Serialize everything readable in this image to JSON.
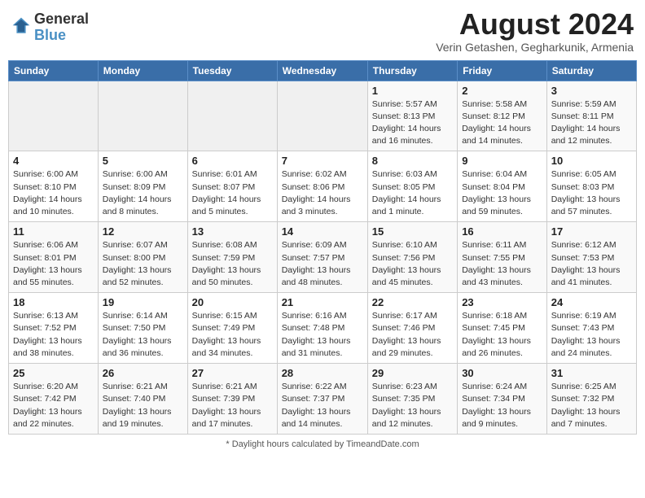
{
  "header": {
    "logo_line1": "General",
    "logo_line2": "Blue",
    "month": "August 2024",
    "location": "Verin Getashen, Gegharkunik, Armenia"
  },
  "weekdays": [
    "Sunday",
    "Monday",
    "Tuesday",
    "Wednesday",
    "Thursday",
    "Friday",
    "Saturday"
  ],
  "weeks": [
    [
      {
        "day": "",
        "info": ""
      },
      {
        "day": "",
        "info": ""
      },
      {
        "day": "",
        "info": ""
      },
      {
        "day": "",
        "info": ""
      },
      {
        "day": "1",
        "info": "Sunrise: 5:57 AM\nSunset: 8:13 PM\nDaylight: 14 hours\nand 16 minutes."
      },
      {
        "day": "2",
        "info": "Sunrise: 5:58 AM\nSunset: 8:12 PM\nDaylight: 14 hours\nand 14 minutes."
      },
      {
        "day": "3",
        "info": "Sunrise: 5:59 AM\nSunset: 8:11 PM\nDaylight: 14 hours\nand 12 minutes."
      }
    ],
    [
      {
        "day": "4",
        "info": "Sunrise: 6:00 AM\nSunset: 8:10 PM\nDaylight: 14 hours\nand 10 minutes."
      },
      {
        "day": "5",
        "info": "Sunrise: 6:00 AM\nSunset: 8:09 PM\nDaylight: 14 hours\nand 8 minutes."
      },
      {
        "day": "6",
        "info": "Sunrise: 6:01 AM\nSunset: 8:07 PM\nDaylight: 14 hours\nand 5 minutes."
      },
      {
        "day": "7",
        "info": "Sunrise: 6:02 AM\nSunset: 8:06 PM\nDaylight: 14 hours\nand 3 minutes."
      },
      {
        "day": "8",
        "info": "Sunrise: 6:03 AM\nSunset: 8:05 PM\nDaylight: 14 hours\nand 1 minute."
      },
      {
        "day": "9",
        "info": "Sunrise: 6:04 AM\nSunset: 8:04 PM\nDaylight: 13 hours\nand 59 minutes."
      },
      {
        "day": "10",
        "info": "Sunrise: 6:05 AM\nSunset: 8:03 PM\nDaylight: 13 hours\nand 57 minutes."
      }
    ],
    [
      {
        "day": "11",
        "info": "Sunrise: 6:06 AM\nSunset: 8:01 PM\nDaylight: 13 hours\nand 55 minutes."
      },
      {
        "day": "12",
        "info": "Sunrise: 6:07 AM\nSunset: 8:00 PM\nDaylight: 13 hours\nand 52 minutes."
      },
      {
        "day": "13",
        "info": "Sunrise: 6:08 AM\nSunset: 7:59 PM\nDaylight: 13 hours\nand 50 minutes."
      },
      {
        "day": "14",
        "info": "Sunrise: 6:09 AM\nSunset: 7:57 PM\nDaylight: 13 hours\nand 48 minutes."
      },
      {
        "day": "15",
        "info": "Sunrise: 6:10 AM\nSunset: 7:56 PM\nDaylight: 13 hours\nand 45 minutes."
      },
      {
        "day": "16",
        "info": "Sunrise: 6:11 AM\nSunset: 7:55 PM\nDaylight: 13 hours\nand 43 minutes."
      },
      {
        "day": "17",
        "info": "Sunrise: 6:12 AM\nSunset: 7:53 PM\nDaylight: 13 hours\nand 41 minutes."
      }
    ],
    [
      {
        "day": "18",
        "info": "Sunrise: 6:13 AM\nSunset: 7:52 PM\nDaylight: 13 hours\nand 38 minutes."
      },
      {
        "day": "19",
        "info": "Sunrise: 6:14 AM\nSunset: 7:50 PM\nDaylight: 13 hours\nand 36 minutes."
      },
      {
        "day": "20",
        "info": "Sunrise: 6:15 AM\nSunset: 7:49 PM\nDaylight: 13 hours\nand 34 minutes."
      },
      {
        "day": "21",
        "info": "Sunrise: 6:16 AM\nSunset: 7:48 PM\nDaylight: 13 hours\nand 31 minutes."
      },
      {
        "day": "22",
        "info": "Sunrise: 6:17 AM\nSunset: 7:46 PM\nDaylight: 13 hours\nand 29 minutes."
      },
      {
        "day": "23",
        "info": "Sunrise: 6:18 AM\nSunset: 7:45 PM\nDaylight: 13 hours\nand 26 minutes."
      },
      {
        "day": "24",
        "info": "Sunrise: 6:19 AM\nSunset: 7:43 PM\nDaylight: 13 hours\nand 24 minutes."
      }
    ],
    [
      {
        "day": "25",
        "info": "Sunrise: 6:20 AM\nSunset: 7:42 PM\nDaylight: 13 hours\nand 22 minutes."
      },
      {
        "day": "26",
        "info": "Sunrise: 6:21 AM\nSunset: 7:40 PM\nDaylight: 13 hours\nand 19 minutes."
      },
      {
        "day": "27",
        "info": "Sunrise: 6:21 AM\nSunset: 7:39 PM\nDaylight: 13 hours\nand 17 minutes."
      },
      {
        "day": "28",
        "info": "Sunrise: 6:22 AM\nSunset: 7:37 PM\nDaylight: 13 hours\nand 14 minutes."
      },
      {
        "day": "29",
        "info": "Sunrise: 6:23 AM\nSunset: 7:35 PM\nDaylight: 13 hours\nand 12 minutes."
      },
      {
        "day": "30",
        "info": "Sunrise: 6:24 AM\nSunset: 7:34 PM\nDaylight: 13 hours\nand 9 minutes."
      },
      {
        "day": "31",
        "info": "Sunrise: 6:25 AM\nSunset: 7:32 PM\nDaylight: 13 hours\nand 7 minutes."
      }
    ]
  ],
  "footer": "Daylight hours"
}
